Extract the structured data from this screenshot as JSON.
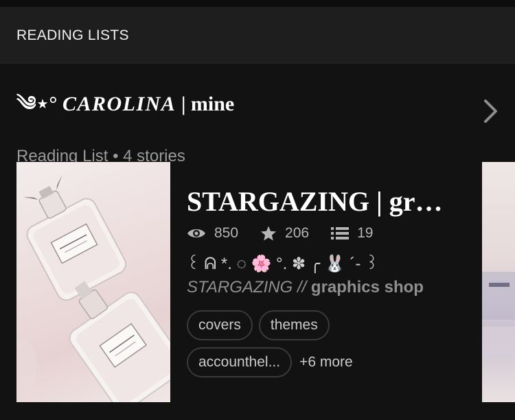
{
  "header": {
    "title": "READING LISTS"
  },
  "reading_list": {
    "title_deco": "༄⋆°",
    "title_name": "CAROLINA",
    "title_suffix": " | mine",
    "subtitle": "Reading List • 4 stories"
  },
  "story": {
    "title": "STARGAZING | graphics shop",
    "views": "850",
    "votes": "206",
    "parts": "19",
    "deco_line": "꒰ ᕱ *. ◌ 🌸 °. ✽ ╭ 🐰 ´- ꒱",
    "description_italic": "STARGAZING //",
    "description_bold": " graphics shop",
    "tags": [
      "covers",
      "themes",
      "accounthel..."
    ],
    "more_tags": "+6 more"
  },
  "icons": {
    "views": "eye-icon",
    "votes": "star-icon",
    "parts": "list-icon",
    "next": "chevron-right-icon"
  },
  "colors": {
    "background": "#121212",
    "header_bg": "#1e1e1e",
    "text_primary": "#ffffff",
    "text_secondary": "#9a9a9a",
    "tag_border": "#3a3a3a"
  }
}
